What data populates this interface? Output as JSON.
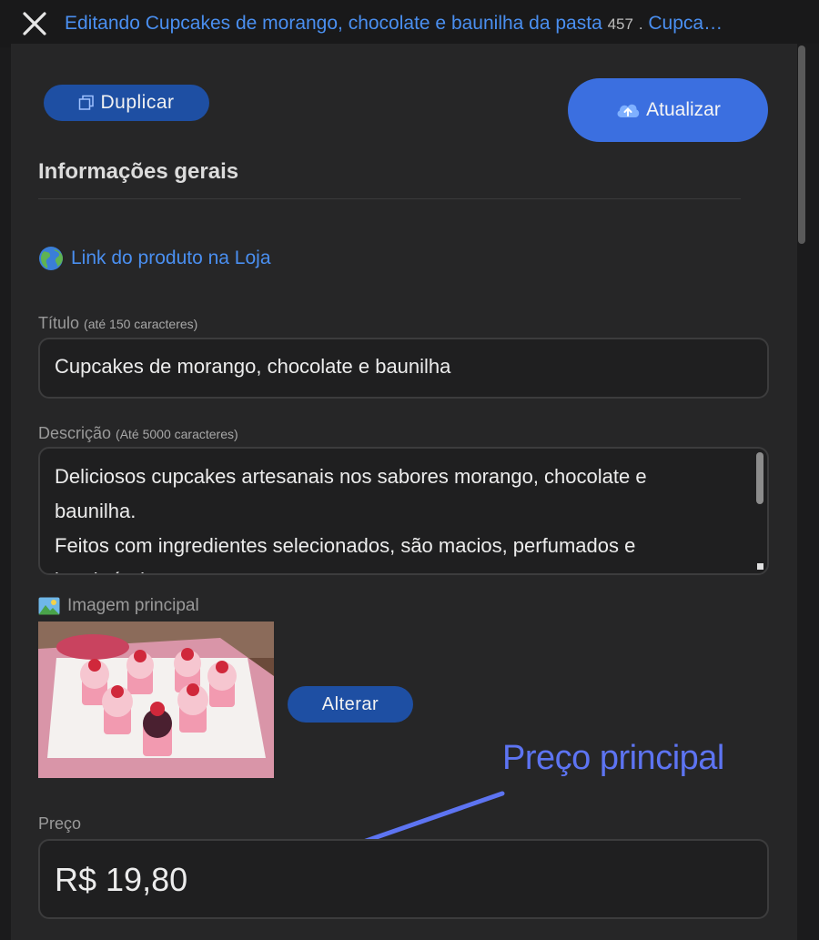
{
  "header": {
    "title_link": "Editando Cupcakes de morango, chocolate e baunilha da pasta",
    "folder_id": "457",
    "separator": ".",
    "tail_link": "Cupca…"
  },
  "toolbar": {
    "duplicate_label": "Duplicar",
    "update_label": "Atualizar"
  },
  "section": {
    "title": "Informações gerais"
  },
  "store_link": {
    "label": "Link do produto na Loja"
  },
  "title_field": {
    "label": "Título",
    "hint": "(até 150 caracteres)",
    "value": "Cupcakes de morango, chocolate e baunilha"
  },
  "description_field": {
    "label": "Descrição",
    "hint": "(Até 5000 caracteres)",
    "value": "Deliciosos cupcakes artesanais nos sabores morango, chocolate e baunilha.\nFeitos com ingredientes selecionados, são macios, perfumados e irresistíveis."
  },
  "image": {
    "label": "Imagem principal",
    "change_label": "Alterar"
  },
  "price_field": {
    "label": "Preço",
    "value": "R$ 19,80"
  },
  "annotation": {
    "text": "Preço principal"
  },
  "colors": {
    "accent": "#3b6fe0",
    "button_dark": "#1e4fa3",
    "link": "#4a8ff0",
    "annotation": "#5d74f2"
  }
}
